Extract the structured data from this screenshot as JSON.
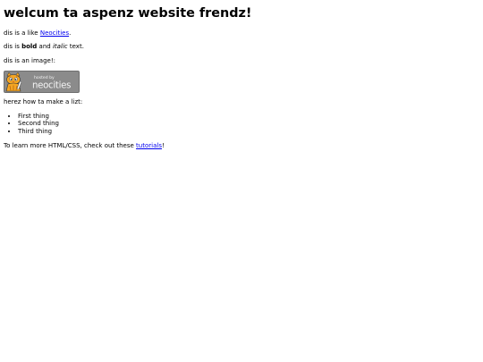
{
  "heading": "welcum ta aspenz website frendz!",
  "intro": {
    "prefix": "dis is a like ",
    "link_text": "Neocities",
    "suffix": "."
  },
  "formatting": {
    "prefix": "dis is ",
    "bold": "bold",
    "middle": " and ",
    "italic": "italic",
    "suffix": " text."
  },
  "image_caption": "dis is an image!:",
  "banner": {
    "line1": "hosted by",
    "line2": "neocities",
    "icon": "neocities-cat-icon",
    "colors": {
      "background": "#8b8b8b",
      "border": "#6f6f6f",
      "cat_body": "#f5a623",
      "cat_stripe": "#b8660f",
      "text": "#f4f4f4"
    }
  },
  "list_intro": "herez how ta make a lizt:",
  "list": [
    "First thing",
    "Second thing",
    "Third thing"
  ],
  "outro": {
    "prefix": "To learn more HTML/CSS, check out these ",
    "link_text": "tutorials",
    "suffix": "!"
  }
}
